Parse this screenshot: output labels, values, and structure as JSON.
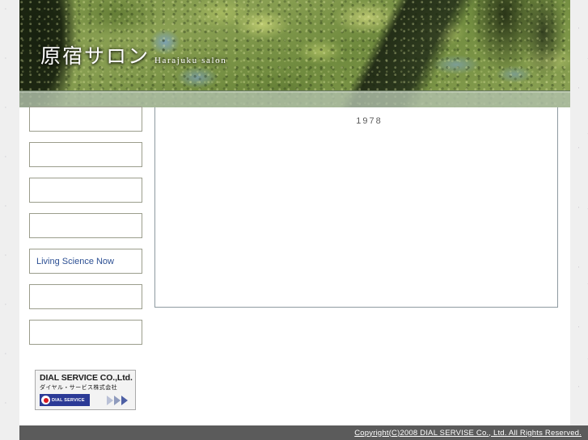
{
  "header": {
    "title_jp": "原宿サロン",
    "title_en": "Harajuku salon",
    "photo_description": "forest-trees-photo"
  },
  "sidebar": {
    "items": [
      {
        "label": ""
      },
      {
        "label": ""
      },
      {
        "label": ""
      },
      {
        "label": ""
      },
      {
        "label": "Living Science Now"
      },
      {
        "label": ""
      },
      {
        "label": ""
      }
    ],
    "banner": {
      "company_en": "DIAL SERVICE CO.,Ltd.",
      "company_jp": "ダイヤル・サービス株式会社",
      "logo_text": "DIAL SERVICE"
    }
  },
  "main": {
    "year": "1978"
  },
  "footer": {
    "copyright": "Copyright(C)2008 DIAL SERVISE Co., Ltd. All Rights Reserved."
  },
  "colors": {
    "link_blue": "#2c4f93",
    "footer_bar": "#5b5b5b",
    "box_border": "#9b9d8c",
    "content_border": "#8e9aa0",
    "logo_blue": "#2b3a96",
    "logo_red": "#d81820"
  }
}
